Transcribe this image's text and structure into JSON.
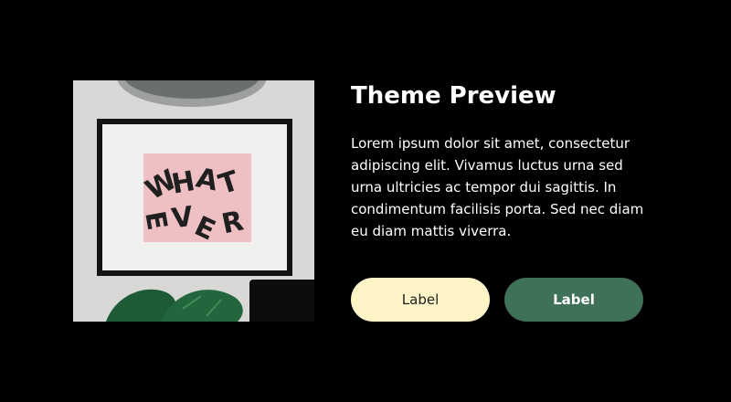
{
  "card": {
    "image": {
      "alt": "Framed print with the word WHATEVER on a pink background",
      "print_letters": [
        "W",
        "H",
        "A",
        "T",
        "E",
        "V",
        "E",
        "R"
      ]
    },
    "title": "Theme Preview",
    "body": "Lorem ipsum dolor sit amet, consectetur adipiscing elit. Vivamus luctus urna sed urna ultricies ac tempor dui sagittis. In condimentum facilisis porta. Sed nec diam eu diam mattis viverra.",
    "buttons": {
      "primary_label": "Label",
      "secondary_label": "Label"
    }
  },
  "colors": {
    "background": "#000000",
    "primary_button": "#fff4c8",
    "secondary_button": "#3e7158",
    "text": "#ffffff"
  }
}
